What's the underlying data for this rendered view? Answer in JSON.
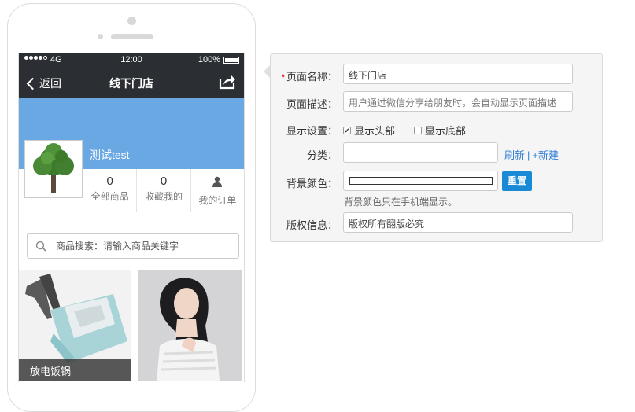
{
  "phone": {
    "status": {
      "network": "4G",
      "time": "12:00",
      "battery": "100%"
    },
    "nav": {
      "back_label": "返回",
      "title": "线下门店",
      "share_icon": "share-icon"
    },
    "store": {
      "name": "测试test",
      "banner_color": "#6aa8e4",
      "stats": [
        {
          "num": "0",
          "label": "全部商品"
        },
        {
          "num": "0",
          "label": "收藏我的"
        },
        {
          "label": "我的订单",
          "icon": "person-icon"
        }
      ]
    },
    "search": {
      "placeholder": "商品搜索：请输入商品关键字"
    },
    "products": [
      {
        "caption": "放电饭锅"
      },
      {
        "caption": ""
      }
    ]
  },
  "form": {
    "page_name": {
      "label": "页面名称：",
      "value": "线下门店",
      "required": "*"
    },
    "page_desc": {
      "label": "页面描述：",
      "placeholder": "用户通过微信分享给朋友时，会自动显示页面描述"
    },
    "display": {
      "label": "显示设置：",
      "show_header": "显示头部",
      "show_footer": "显示底部",
      "show_header_checked": true,
      "show_footer_checked": false
    },
    "category": {
      "label": "分类：",
      "refresh": "刷新",
      "sep": "|",
      "add_new": "+新建"
    },
    "bg_color": {
      "label": "背景颜色：",
      "reset": "重置",
      "hint": "背景颜色只在手机端显示。"
    },
    "copyright": {
      "label": "版权信息：",
      "value": "版权所有翻版必究"
    }
  },
  "colors": {
    "accent": "#1a8ad6",
    "link": "#2e7fd8",
    "nav_bg": "#2b2f33"
  }
}
